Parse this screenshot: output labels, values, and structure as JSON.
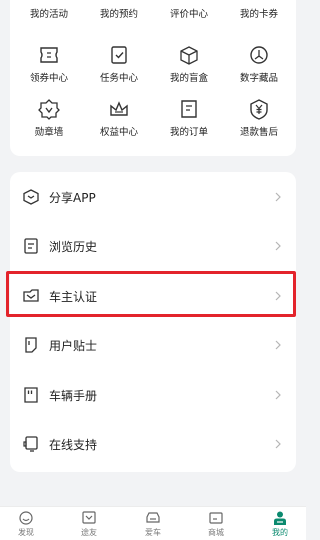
{
  "grid": {
    "row1": [
      "我的活动",
      "我的预约",
      "评价中心",
      "我的卡券"
    ],
    "row2": [
      "领券中心",
      "任务中心",
      "我的盲盒",
      "数字藏品"
    ],
    "row3": [
      "勋章墙",
      "权益中心",
      "我的订单",
      "退款售后"
    ]
  },
  "menu": {
    "items": [
      {
        "label": "分享APP",
        "icon": "share-cube-icon"
      },
      {
        "label": "浏览历史",
        "icon": "history-doc-icon"
      },
      {
        "label": "车主认证",
        "icon": "owner-verify-icon"
      },
      {
        "label": "用户贴士",
        "icon": "tips-icon"
      },
      {
        "label": "车辆手册",
        "icon": "manual-icon"
      },
      {
        "label": "在线支持",
        "icon": "support-icon"
      }
    ],
    "highlighted_index": 2
  },
  "tabbar": {
    "tabs": [
      {
        "label": "发现",
        "icon": "discover-icon"
      },
      {
        "label": "途友",
        "icon": "friends-icon"
      },
      {
        "label": "爱车",
        "icon": "car-icon"
      },
      {
        "label": "商城",
        "icon": "store-icon"
      },
      {
        "label": "我的",
        "icon": "profile-icon"
      }
    ],
    "active_index": 4
  },
  "colors": {
    "accent": "#0b8a6f",
    "highlight": "#e3232b",
    "icon_stroke": "#333333"
  }
}
